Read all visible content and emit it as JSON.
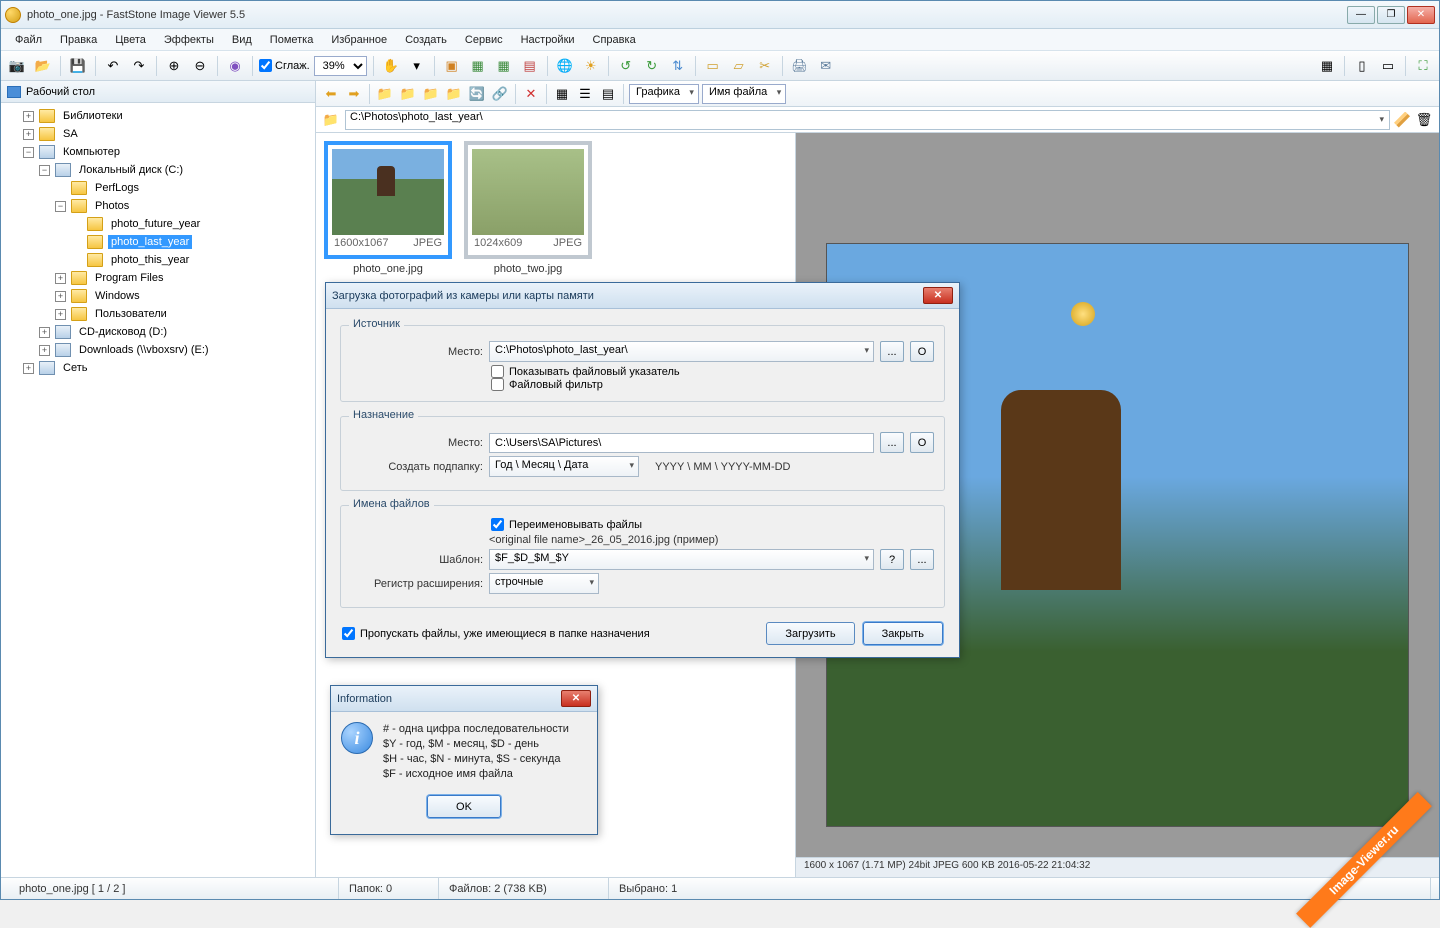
{
  "window": {
    "title": "photo_one.jpg  -  FastStone Image Viewer 5.5",
    "min": "—",
    "max": "❐",
    "close": "✕"
  },
  "menu": [
    "Файл",
    "Правка",
    "Цвета",
    "Эффекты",
    "Вид",
    "Пометка",
    "Избранное",
    "Создать",
    "Сервис",
    "Настройки",
    "Справка"
  ],
  "toolbar": {
    "smooth": "Сглаж.",
    "zoom": "39%"
  },
  "sidebar": {
    "header": "Рабочий стол",
    "nodes": [
      {
        "ind": 1,
        "tw": "+",
        "icon": "folder",
        "label": "Библиотеки"
      },
      {
        "ind": 1,
        "tw": "+",
        "icon": "folder",
        "label": "SA"
      },
      {
        "ind": 1,
        "tw": "−",
        "icon": "drive",
        "label": "Компьютер"
      },
      {
        "ind": 2,
        "tw": "−",
        "icon": "drive",
        "label": "Локальный диск (C:)"
      },
      {
        "ind": 3,
        "tw": "",
        "icon": "folder",
        "label": "PerfLogs"
      },
      {
        "ind": 3,
        "tw": "−",
        "icon": "folder",
        "label": "Photos"
      },
      {
        "ind": 4,
        "tw": "",
        "icon": "folder",
        "label": "photo_future_year"
      },
      {
        "ind": 4,
        "tw": "",
        "icon": "folder",
        "label": "photo_last_year",
        "sel": true
      },
      {
        "ind": 4,
        "tw": "",
        "icon": "folder",
        "label": "photo_this_year"
      },
      {
        "ind": 3,
        "tw": "+",
        "icon": "folder",
        "label": "Program Files"
      },
      {
        "ind": 3,
        "tw": "+",
        "icon": "folder",
        "label": "Windows"
      },
      {
        "ind": 3,
        "tw": "+",
        "icon": "folder",
        "label": "Пользователи"
      },
      {
        "ind": 2,
        "tw": "+",
        "icon": "drive",
        "label": "CD-дисковод (D:)"
      },
      {
        "ind": 2,
        "tw": "+",
        "icon": "drive",
        "label": "Downloads (\\\\vboxsrv) (E:)"
      },
      {
        "ind": 1,
        "tw": "+",
        "icon": "drive",
        "label": "Сеть"
      }
    ]
  },
  "nav": {
    "group_by": "Графика",
    "sort_by": "Имя файла"
  },
  "path": "C:\\Photos\\photo_last_year\\",
  "thumbs": [
    {
      "dim": "1600x1067",
      "fmt": "JPEG",
      "name": "photo_one.jpg",
      "sel": true,
      "cls": "thumbimg"
    },
    {
      "dim": "1024x609",
      "fmt": "JPEG",
      "name": "photo_two.jpg",
      "sel": false,
      "cls": "thumbimg2"
    }
  ],
  "preview_status": "1600 x 1067 (1.71 MP)   24bit  JPEG   600 KB   2016-05-22 21:04:32",
  "status": {
    "file": "photo_one.jpg  [ 1 / 2 ]",
    "folders": "Папок: 0",
    "files": "Файлов: 2 (738 KB)",
    "selected": "Выбрано: 1"
  },
  "dialog1": {
    "title": "Загрузка фотографий из камеры или карты памяти",
    "g1": "Источник",
    "place_lbl": "Место:",
    "src_path": "C:\\Photos\\photo_last_year\\",
    "browse": "...",
    "open": "O",
    "chk_pointer": "Показывать файловый указатель",
    "chk_filter": "Файловый фильтр",
    "g2": "Назначение",
    "dst_path": "C:\\Users\\SA\\Pictures\\",
    "subfolder_lbl": "Создать подпапку:",
    "subfolder_val": "Год \\ Месяц \\ Дата",
    "subfolder_hint": "YYYY \\ MM \\ YYYY-MM-DD",
    "g3": "Имена файлов",
    "chk_rename": "Переименовывать файлы",
    "example": "<original file name>_26_05_2016.jpg   (пример)",
    "template_lbl": "Шаблон:",
    "template_val": "$F_$D_$M_$Y",
    "help": "?",
    "case_lbl": "Регистр расширения:",
    "case_val": "строчные",
    "chk_skip": "Пропускать файлы, уже имеющиеся в папке назначения",
    "btn_load": "Загрузить",
    "btn_close": "Закрыть"
  },
  "dialog2": {
    "title": "Information",
    "l1": "#  - одна цифра последовательности",
    "l2": "$Y - год, $M - месяц, $D - день",
    "l3": "$H - час, $N - минута, $S - секунда",
    "l4": "$F - исходное имя файла",
    "ok": "OK"
  },
  "watermark": "Image-Viewer.ru"
}
